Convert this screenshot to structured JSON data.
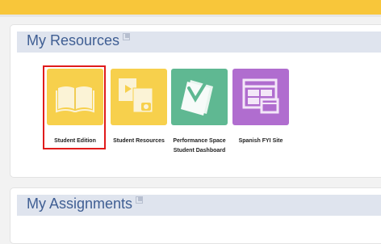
{
  "resources": {
    "title": "My Resources",
    "tiles": [
      {
        "label": "Student Edition",
        "icon": "book-icon",
        "color": "#f7d04c"
      },
      {
        "label": "Student Resources",
        "icon": "media-files-icon",
        "color": "#f7d04c"
      },
      {
        "label": "Performance Space Student Dashboard",
        "icon": "paper-checkmark-icon",
        "color": "#5fb892"
      },
      {
        "label": "Spanish FYI Site",
        "icon": "website-icon",
        "color": "#b06dcf"
      }
    ]
  },
  "assignments": {
    "title": "My Assignments"
  },
  "colors": {
    "top_bar": "#f8c63a",
    "header_band": "#dfe4ee",
    "title_text": "#3f5e93",
    "selection_outline": "#e01b1b"
  }
}
